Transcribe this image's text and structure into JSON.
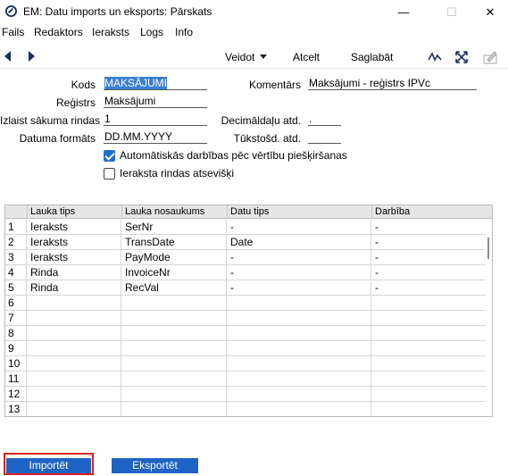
{
  "window": {
    "title": "EM: Datu imports un eksports: Pārskats",
    "minimize": "—",
    "maximize": "☐",
    "close": "✕"
  },
  "menu": [
    "Fails",
    "Redaktors",
    "Ieraksts",
    "Logs",
    "Info"
  ],
  "toolbar": {
    "view_label": "Veidot",
    "cancel_label": "Atcelt",
    "save_label": "Saglabāt",
    "icons": [
      "arrow-left-icon",
      "arrow-right-icon",
      "signature-icon",
      "resize-icon",
      "edit-pencil-icon"
    ]
  },
  "form": {
    "kods_label": "Kods",
    "kods_value": "MAKSĀJUMI",
    "komentars_label": "Komentārs",
    "komentars_value": "Maksājumi - reģistrs IPVc",
    "registrs_label": "Reģistrs",
    "registrs_value": "Maksājumi",
    "izlaist_label": "Izlaist sākuma rindas",
    "izlaist_value": "1",
    "decimal_label": "Decimāldaļu atd.",
    "decimal_value": ".",
    "datuma_label": "Datuma formāts",
    "datuma_value": "DD.MM.YYYY",
    "tukst_label": "Tūkstošd. atd.",
    "tukst_value": "",
    "cb_auto_label": "Automātiskās darbības pēc vērtību piešķiršanas",
    "cb_auto_checked": true,
    "cb_separate_label": "Ieraksta rindas atsevišķi",
    "cb_separate_checked": false
  },
  "table": {
    "headers": [
      "",
      "Lauka tips",
      "Lauka nosaukums",
      "Datu tips",
      "Darbība"
    ],
    "rows": [
      [
        "1",
        "Ieraksts",
        "SerNr",
        "-",
        "-"
      ],
      [
        "2",
        "Ieraksts",
        "TransDate",
        "Date",
        "-"
      ],
      [
        "3",
        "Ieraksts",
        "PayMode",
        "-",
        "-"
      ],
      [
        "4",
        "Rinda",
        "InvoiceNr",
        "-",
        "-"
      ],
      [
        "5",
        "Rinda",
        "RecVal",
        "-",
        "-"
      ],
      [
        "6",
        "",
        "",
        "",
        ""
      ],
      [
        "7",
        "",
        "",
        "",
        ""
      ],
      [
        "8",
        "",
        "",
        "",
        ""
      ],
      [
        "9",
        "",
        "",
        "",
        ""
      ],
      [
        "10",
        "",
        "",
        "",
        ""
      ],
      [
        "11",
        "",
        "",
        "",
        ""
      ],
      [
        "12",
        "",
        "",
        "",
        ""
      ],
      [
        "13",
        "",
        "",
        "",
        ""
      ]
    ]
  },
  "buttons": {
    "import_label": "Importēt",
    "export_label": "Eksportēt"
  },
  "colors": {
    "accent": "#1f63c5",
    "highlight": "#e0201e",
    "selection": "#3a7fd5"
  }
}
